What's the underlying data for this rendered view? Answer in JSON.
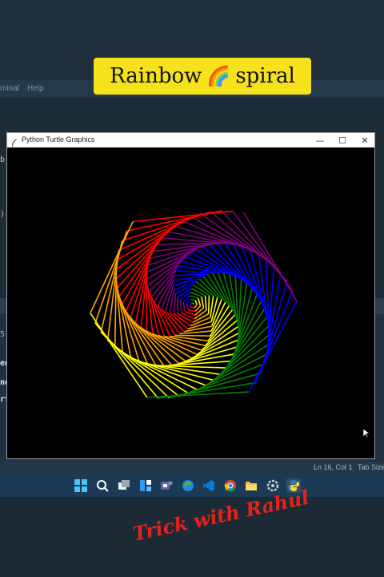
{
  "banner": {
    "text_left": "Rainbow",
    "emoji": "🌈",
    "text_right": "spiral"
  },
  "editor": {
    "menu": [
      "minal",
      "Help"
    ],
    "code_fragments": [
      "b.",
      ")"
    ],
    "terminal_fragments": [
      "5",
      "en",
      "ne",
      "rt"
    ]
  },
  "turtle_window": {
    "title": "Python Turtle Graphics",
    "controls": {
      "minimize": "—",
      "maximize": "☐",
      "close": "✕"
    }
  },
  "statusbar": {
    "position": "Ln 16, Col 1",
    "tab": "Tab Size:"
  },
  "taskbar": {
    "icons": [
      "windows-start-icon",
      "search-icon",
      "task-view-icon",
      "widgets-icon",
      "teams-chat-icon",
      "edge-icon",
      "vscode-icon",
      "chrome-icon",
      "file-explorer-icon",
      "settings-icon",
      "python-icon"
    ]
  },
  "overlay": {
    "signature": "Trick with Rahul"
  },
  "colors": {
    "banner_bg": "#f5e21a",
    "signature": "#e8211a",
    "spiral": [
      "#ff0000",
      "#ffa500",
      "#ffff00",
      "#008000",
      "#0000ff",
      "#800080"
    ]
  }
}
